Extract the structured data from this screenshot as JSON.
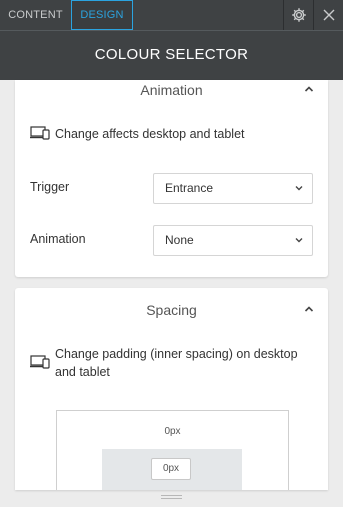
{
  "tabs": [
    {
      "label": "CONTENT",
      "active": false
    },
    {
      "label": "DESIGN",
      "active": true
    }
  ],
  "header": {
    "title": "COLOUR SELECTOR"
  },
  "icons": {
    "settings": "gear-icon",
    "close": "close-icon",
    "devices": "desktop-tablet-icon"
  },
  "animation_section": {
    "title": "Animation",
    "note": "Change affects desktop and tablet",
    "trigger": {
      "label": "Trigger",
      "value": "Entrance"
    },
    "animation": {
      "label": "Animation",
      "value": "None"
    }
  },
  "spacing_section": {
    "title": "Spacing",
    "note": "Change padding (inner spacing) on desktop and tablet",
    "outer_value": "0px",
    "inner_value": "0px"
  },
  "colors": {
    "accent": "#2ba3df",
    "topbar": "#3f4244",
    "background": "#ececec"
  }
}
